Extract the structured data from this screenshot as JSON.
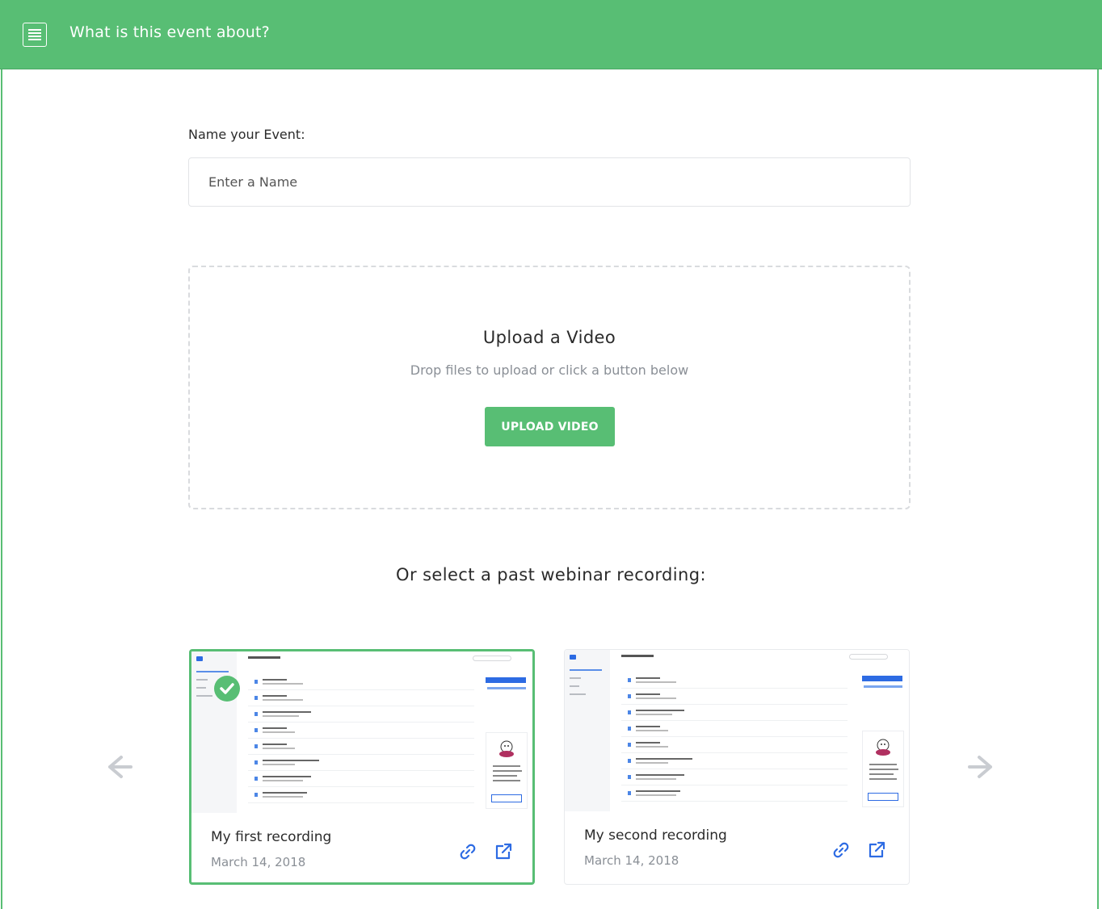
{
  "header": {
    "title": "What is this event about?",
    "icon": "document-lines-icon",
    "color": "#58be74"
  },
  "event_name": {
    "label": "Name your Event:",
    "placeholder": "Enter a Name",
    "value": ""
  },
  "upload": {
    "title": "Upload a Video",
    "subtitle": "Drop files to upload or click a button below",
    "button_label": "UPLOAD VIDEO"
  },
  "past": {
    "title": "Or select a past webinar recording:",
    "recordings": [
      {
        "title": "My first recording",
        "date": "March 14, 2018",
        "selected": true
      },
      {
        "title": "My second recording",
        "date": "March 14, 2018",
        "selected": false
      }
    ]
  },
  "colors": {
    "accent": "#58be74",
    "action_icon": "#2d6be3",
    "arrow": "#c9ccd1"
  }
}
